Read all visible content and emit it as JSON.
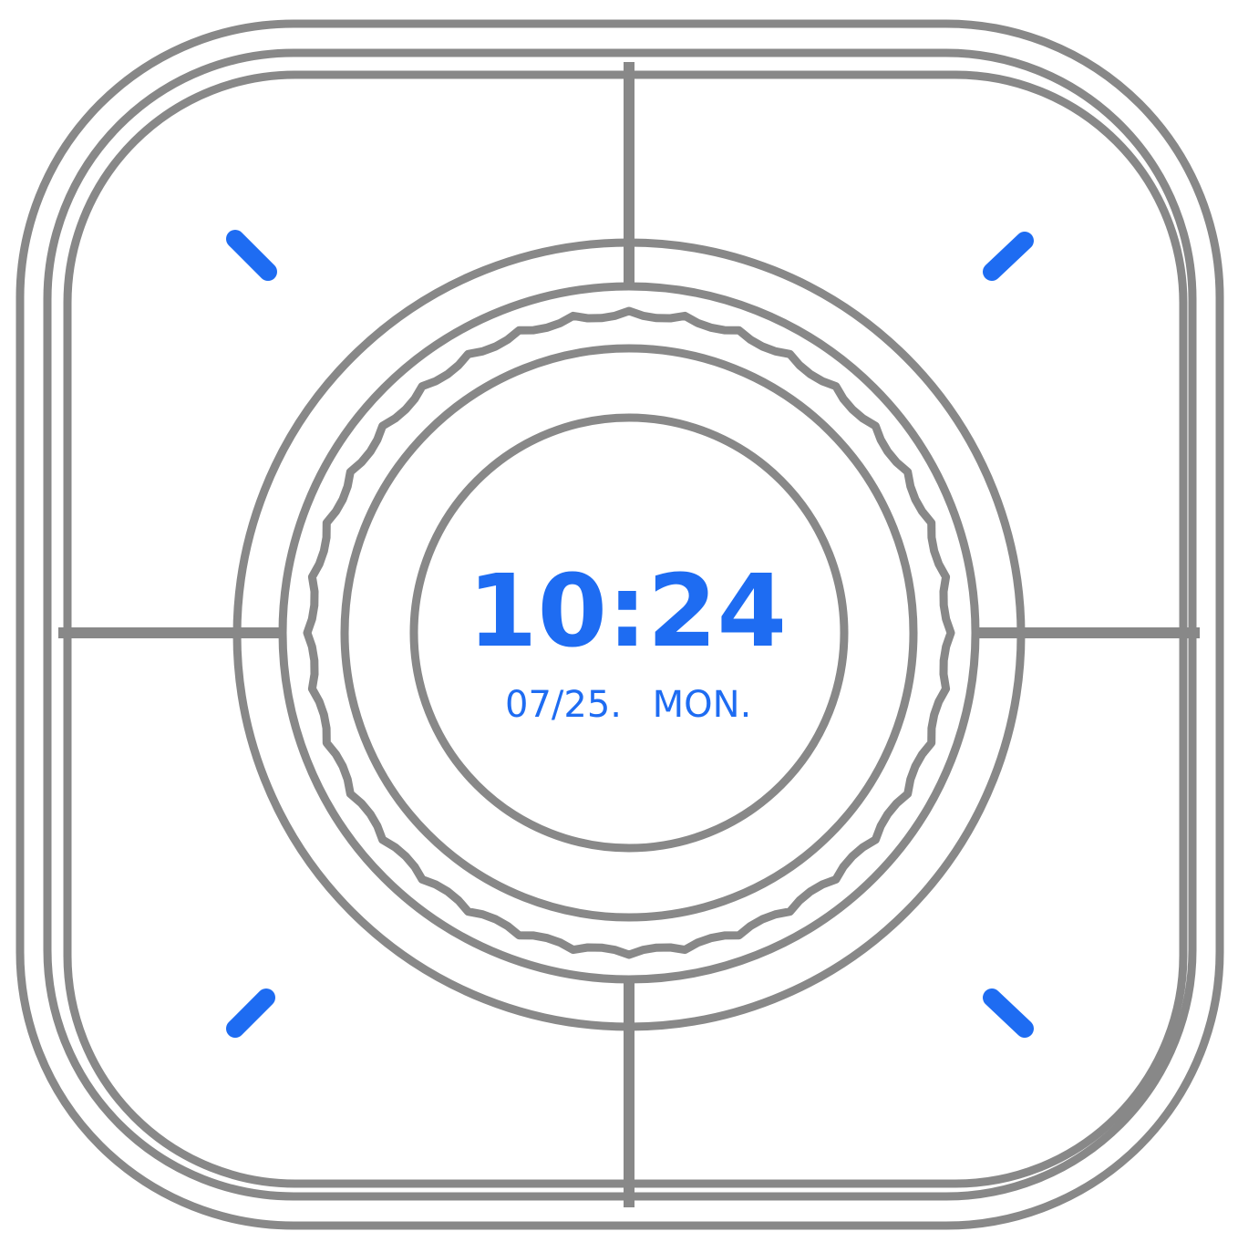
{
  "display": {
    "time": "10:24",
    "date": "07/25.",
    "weekday": "MON."
  },
  "colors": {
    "accent": "#1e6cf2",
    "outline": "#888888",
    "background": "#ffffff"
  },
  "icons": {
    "top_left": "tick-mark-icon",
    "top_right": "tick-mark-icon",
    "bottom_left": "tick-mark-icon",
    "bottom_right": "tick-mark-icon"
  }
}
